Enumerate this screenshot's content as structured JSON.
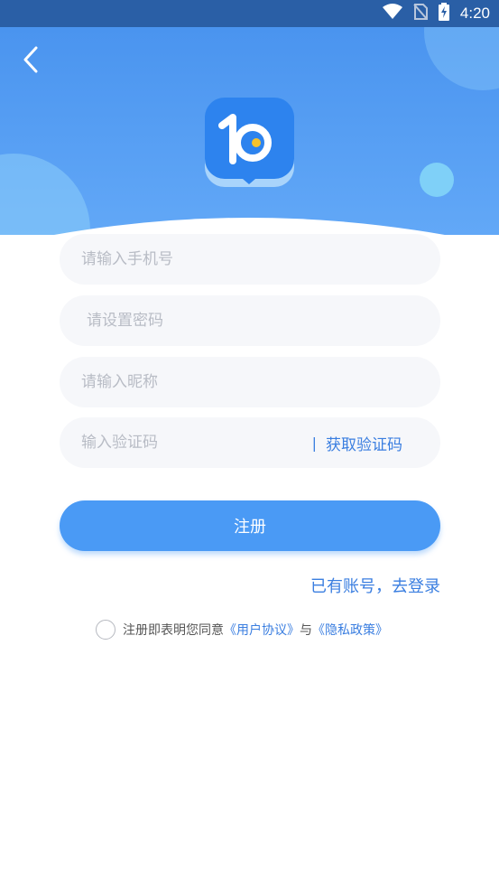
{
  "status_bar": {
    "time": "4:20",
    "icons": [
      "wifi-icon",
      "no-sim-icon",
      "battery-charging-icon"
    ]
  },
  "header": {
    "back_icon": "chevron-left-icon",
    "logo_icon": "app-logo-icon"
  },
  "form": {
    "phone": {
      "placeholder": "请输入手机号",
      "value": ""
    },
    "password": {
      "placeholder": "请设置密码",
      "value": ""
    },
    "nickname": {
      "placeholder": "请输入昵称",
      "value": ""
    },
    "code": {
      "placeholder": "输入验证码",
      "value": ""
    },
    "get_code_separator": "|",
    "get_code_label": "获取验证码"
  },
  "register_label": "注册",
  "login_link": "已有账号，去登录",
  "agreement": {
    "prefix": "注册即表明您同意",
    "user_agreement": "《用户协议》",
    "conjunction": "与",
    "privacy_policy": "《隐私政策》"
  },
  "colors": {
    "status_bar": "#2a5fa6",
    "hero": "#4a94ef",
    "accent": "#4a9af5",
    "link": "#3a7ee0",
    "field_bg": "#f6f7fa"
  }
}
